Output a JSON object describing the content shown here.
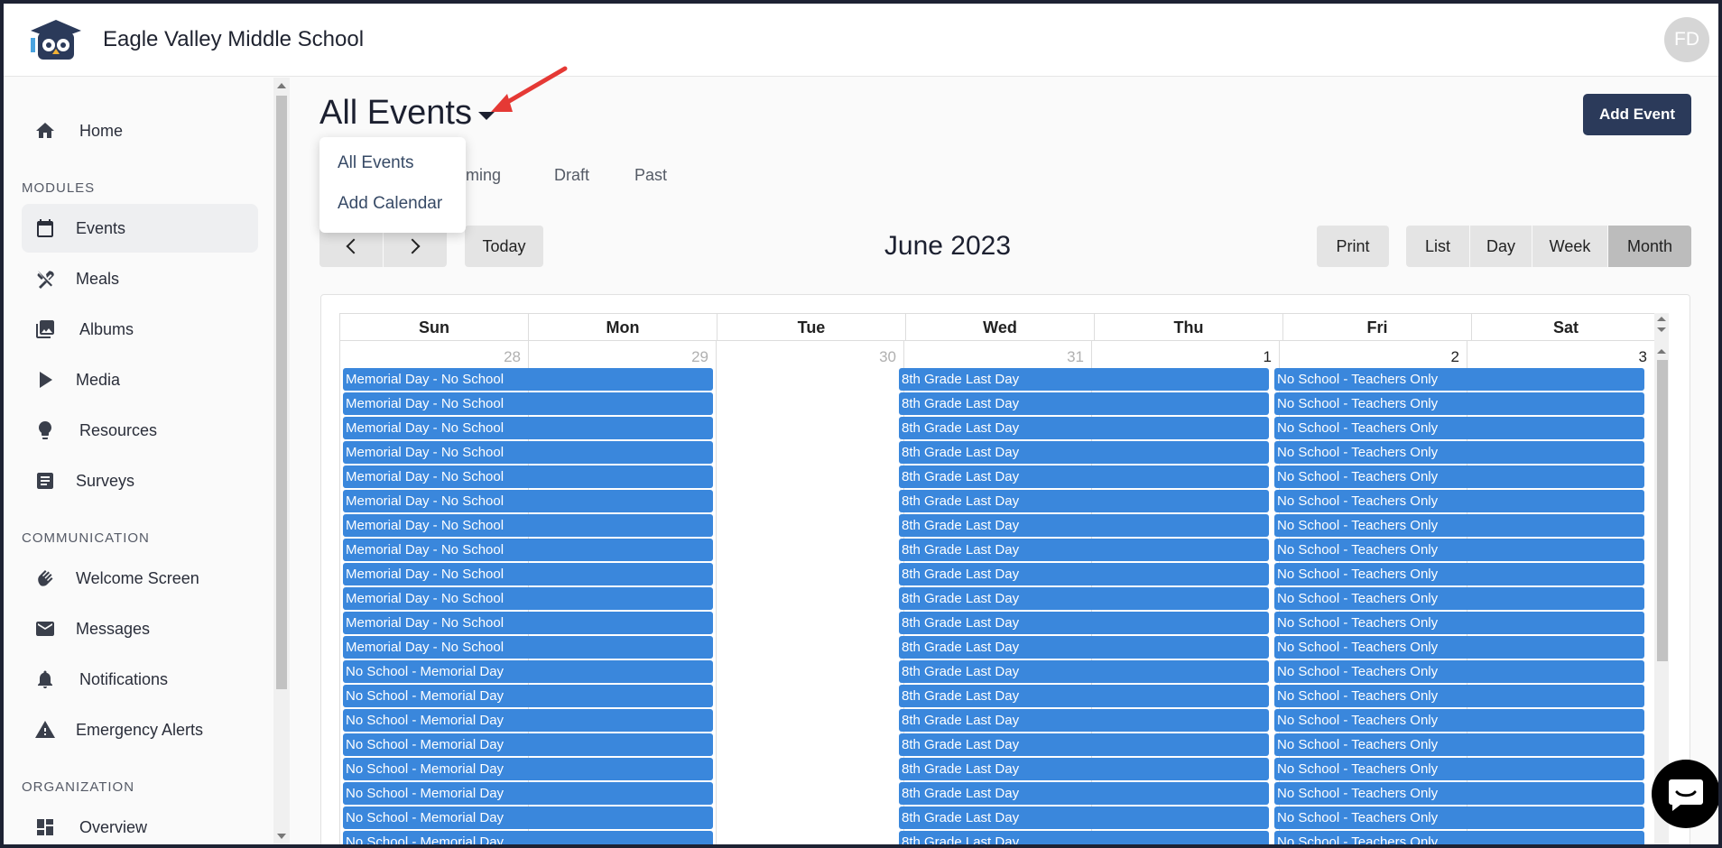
{
  "header": {
    "school_name": "Eagle Valley Middle School",
    "avatar_initials": "FD"
  },
  "sidebar": {
    "home": "Home",
    "modules_label": "MODULES",
    "modules": [
      "Events",
      "Meals",
      "Albums",
      "Media",
      "Resources",
      "Surveys"
    ],
    "communication_label": "COMMUNICATION",
    "communication": [
      "Welcome Screen",
      "Messages",
      "Notifications",
      "Emergency Alerts"
    ],
    "organization_label": "ORGANIZATION",
    "organization": [
      "Overview"
    ]
  },
  "main": {
    "title": "All Events",
    "add_event_label": "Add Event",
    "tabs": [
      "Upcoming",
      "Draft",
      "Past"
    ],
    "tab_visible_fragment": "oming",
    "dropdown": [
      "All Events",
      "Add Calendar"
    ],
    "today_label": "Today",
    "month_title": "June 2023",
    "print_label": "Print",
    "views": [
      "List",
      "Day",
      "Week",
      "Month"
    ],
    "active_view": "Month"
  },
  "calendar": {
    "weekdays": [
      "Sun",
      "Mon",
      "Tue",
      "Wed",
      "Thu",
      "Fri",
      "Sat"
    ],
    "dates": [
      "28",
      "29",
      "30",
      "31",
      "1",
      "2",
      "3"
    ],
    "event_mon_a": "Memorial Day - No School",
    "event_mon_b": "No School - Memorial Day",
    "event_wed": "8th Grade Last Day",
    "event_fri": "No School - Teachers Only",
    "event_color": "#3a87dc"
  },
  "colors": {
    "primary_button": "#2b3a5a",
    "annotation_arrow": "#e53935"
  }
}
